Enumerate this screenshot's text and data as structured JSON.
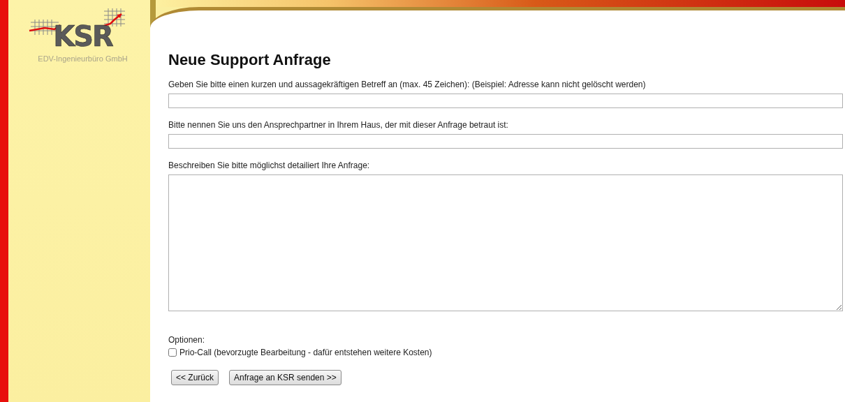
{
  "logo": {
    "text": "KSR",
    "subtitle": "EDV-Ingenieurbüro GmbH"
  },
  "heading": "Neue Support Anfrage",
  "fields": [
    {
      "kind": "input",
      "label": "Geben Sie bitte einen kurzen und aussagekräftigen Betreff an (max. 45 Zeichen): (Beispiel: Adresse kann nicht gelöscht werden)"
    },
    {
      "kind": "input",
      "label": "Bitte nennen Sie uns den Ansprechpartner in Ihrem Haus, der mit dieser Anfrage betraut ist:"
    },
    {
      "kind": "textarea",
      "label": "Beschreiben Sie bitte möglichst detailiert Ihre Anfrage:"
    }
  ],
  "options": {
    "label": "Optionen:",
    "items": [
      {
        "label": "Prio-Call (bevorzugte Bearbeitung - dafür entstehen weitere Kosten)",
        "checked": false
      }
    ]
  },
  "buttons": [
    "<< Zurück",
    "Anfrage an KSR senden >>"
  ]
}
